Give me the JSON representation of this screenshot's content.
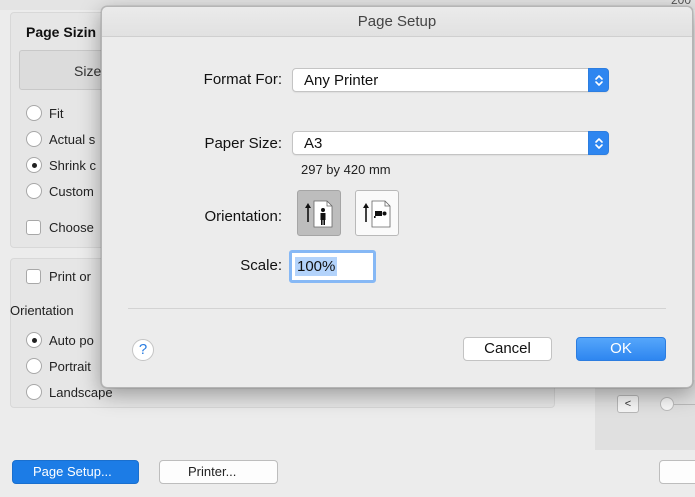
{
  "background_dialog": {
    "corner_number": "200",
    "heading": "Page Sizin",
    "size_button": "Size",
    "scale_options": [
      {
        "label": "Fit",
        "selected": false
      },
      {
        "label": "Actual s",
        "selected": false
      },
      {
        "label": "Shrink c",
        "selected": true
      },
      {
        "label": "Custom",
        "selected": false
      }
    ],
    "choose_checkbox": "Choose",
    "print_checkbox": "Print or",
    "orientation_label": "Orientation",
    "orientation_options": [
      {
        "label": "Auto po",
        "selected": true
      },
      {
        "label": "Portrait",
        "selected": false
      },
      {
        "label": "Landscape",
        "selected": false
      }
    ],
    "prev_page_button": "<",
    "page_setup_button": "Page Setup...",
    "printer_button": "Printer..."
  },
  "page_setup": {
    "title": "Page Setup",
    "format_for_label": "Format For:",
    "format_for_value": "Any Printer",
    "paper_size_label": "Paper Size:",
    "paper_size_value": "A3",
    "paper_dimensions": "297 by 420 mm",
    "orientation_label": "Orientation:",
    "orientation_selected": "portrait",
    "scale_label": "Scale:",
    "scale_value": "100%",
    "help_button": "?",
    "cancel_button": "Cancel",
    "ok_button": "OK"
  },
  "colors": {
    "accent": "#2e86f0",
    "page_setup_button": "#1c7ce6",
    "focus_ring": "#86b8f5",
    "selection": "#b3d3fb"
  },
  "icons": {
    "popup": "up-down-chevrons-icon",
    "portrait": "portrait-person-icon",
    "landscape": "landscape-person-icon"
  }
}
